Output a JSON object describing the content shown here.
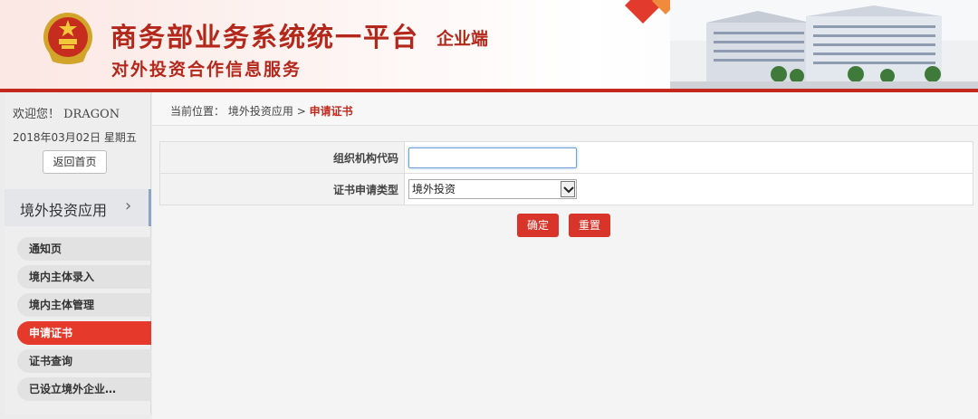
{
  "header": {
    "title": "商务部业务系统统一平台",
    "title_tag": "企业端",
    "subtitle": "对外投资合作信息服务"
  },
  "sidebar": {
    "welcome": "欢迎您！ DRAGON",
    "date": "2018年03月02日 星期五",
    "home_button": "返回首页",
    "section_title": "境外投资应用",
    "menu": [
      {
        "label": "通知页",
        "active": false
      },
      {
        "label": "境内主体录入",
        "active": false
      },
      {
        "label": "境内主体管理",
        "active": false
      },
      {
        "label": "申请证书",
        "active": true
      },
      {
        "label": "证书查询",
        "active": false
      },
      {
        "label": "已设立境外企业…",
        "active": false
      }
    ]
  },
  "breadcrumb": {
    "prefix": "当前位置：",
    "parent": "境外投资应用",
    "separator": ">",
    "current": "申请证书"
  },
  "form": {
    "org_code_label": "组织机构代码",
    "org_code_value": "",
    "cert_type_label": "证书申请类型",
    "cert_type_selected": "境外投资"
  },
  "buttons": {
    "confirm": "确定",
    "reset": "重置"
  },
  "colors": {
    "brand_red": "#c4281c",
    "active_menu": "#e4392b",
    "button_red": "#d9342a"
  }
}
